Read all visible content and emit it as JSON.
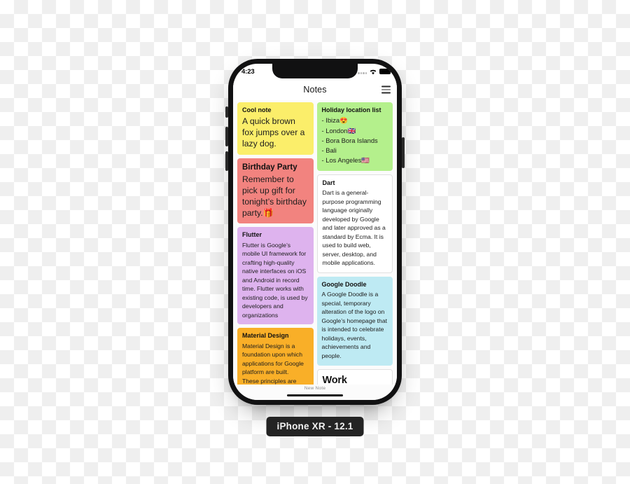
{
  "device": {
    "caption": "iPhone XR - 12.1"
  },
  "status_bar": {
    "time": "4:23",
    "wifi_icon": "wifi-icon",
    "battery_icon": "battery-icon",
    "signal_icon": "signal-dots-icon"
  },
  "header": {
    "title": "Notes",
    "menu_icon": "hamburger-menu-icon"
  },
  "notes": {
    "left_column": [
      {
        "title": "Cool note",
        "body": "A quick brown fox jumps over a lazy dog.",
        "color": "#FBEE6A",
        "title_size": "normal",
        "body_size": "large"
      },
      {
        "title": "Birthday Party",
        "body": "Remember to pick up gift for tonight’s birthday party.🎁",
        "color": "#F2837F",
        "title_size": "large",
        "body_size": "large"
      },
      {
        "title": "Flutter",
        "body": "Flutter is Google’s mobile UI framework for crafting high-quality native interfaces on iOS and Android in record time. Flutter works with existing code, is used by developers and organizations",
        "color": "#DEB3EE",
        "title_size": "normal",
        "body_size": "normal"
      },
      {
        "title": "Material Design",
        "body": "Material Design is a foundation upon which applications for Google platform are built.\nThese principles are",
        "color": "#F9AF28",
        "title_size": "normal",
        "body_size": "normal"
      }
    ],
    "right_column": [
      {
        "title": "Holiday location list",
        "body": "- Ibiza😍\n- London🇬🇧\n- Bora Bora Islands\n- Bali\n- Los Angeles🇺🇸",
        "color": "#B4F08C",
        "title_size": "normal",
        "body_size": "list"
      },
      {
        "title": "Dart",
        "body": "Dart is a general-purpose programming language originally developed by Google and later approved as a standard by Ecma. It is used to build web, server, desktop, and mobile applications.",
        "color": "#FFFFFF",
        "title_size": "normal",
        "body_size": "normal"
      },
      {
        "title": "Google Doodle",
        "body": "A Google Doodle is a special, temporary alteration of the logo on Google’s homepage that is intended to celebrate holidays, events, achievements and people.",
        "color": "#BEEAF3",
        "title_size": "normal",
        "body_size": "normal"
      },
      {
        "title": "Work address",
        "body": "",
        "color": "#FFFFFF",
        "title_size": "big",
        "body_size": "normal"
      }
    ]
  },
  "bottom_bar": {
    "new_note_label": "New Note",
    "home_indicator": "home-indicator"
  },
  "colors": {
    "frame": "#111112",
    "screen_bg": "#fbfbfb",
    "caption_bg": "#242424"
  }
}
